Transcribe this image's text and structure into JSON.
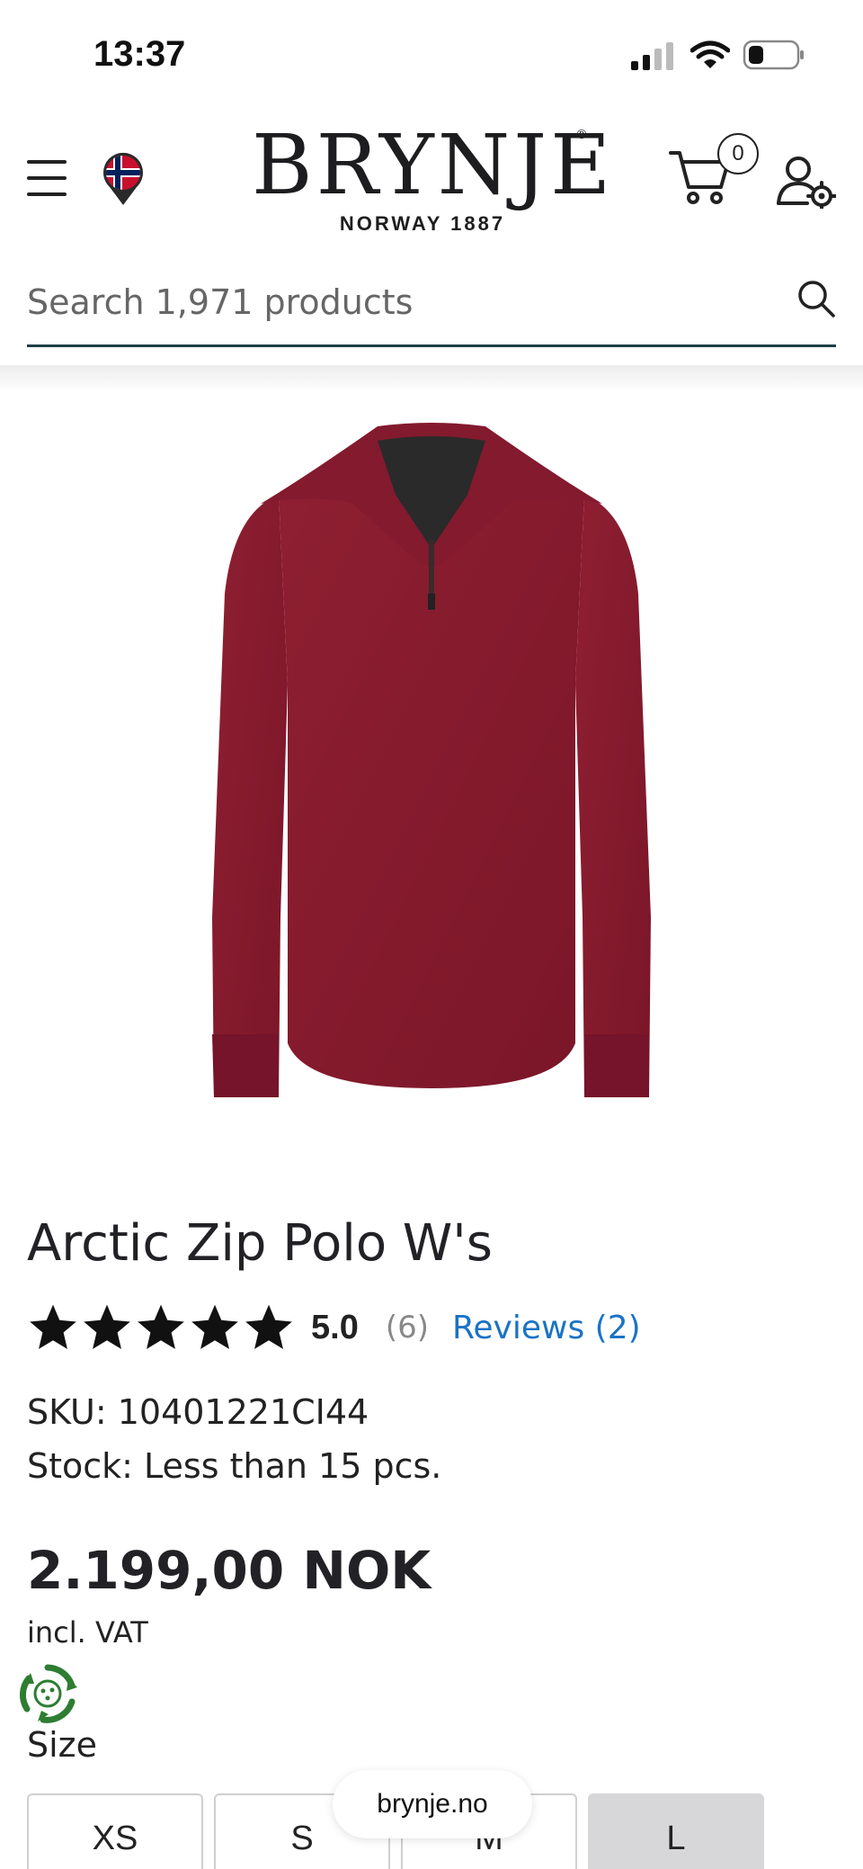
{
  "status_bar": {
    "time": "13:37"
  },
  "header": {
    "logo_text": "BRYNJE",
    "logo_registered": "®",
    "logo_tagline": "NORWAY 1887",
    "cart_count": "0"
  },
  "search": {
    "placeholder": "Search 1,971 products"
  },
  "product": {
    "title": "Arctic Zip Polo W's",
    "rating_stars": 5,
    "rating_score": "5.0",
    "rating_count": "(6)",
    "reviews_link": "Reviews (2)",
    "sku": "SKU: 10401221CI44",
    "stock": "Stock: Less than 15 pcs.",
    "price": "2.199,00 NOK",
    "vat_note": "incl. VAT",
    "image_color": "#8a1c2e"
  },
  "size_selector": {
    "label": "Size",
    "options": [
      "XS",
      "S",
      "M",
      "L"
    ],
    "selected": "L"
  },
  "browser": {
    "domain": "brynje.no"
  },
  "colors": {
    "accent_link": "#1a73c6",
    "search_underline": "#1f3d45",
    "eco_green": "#2e7d32"
  }
}
